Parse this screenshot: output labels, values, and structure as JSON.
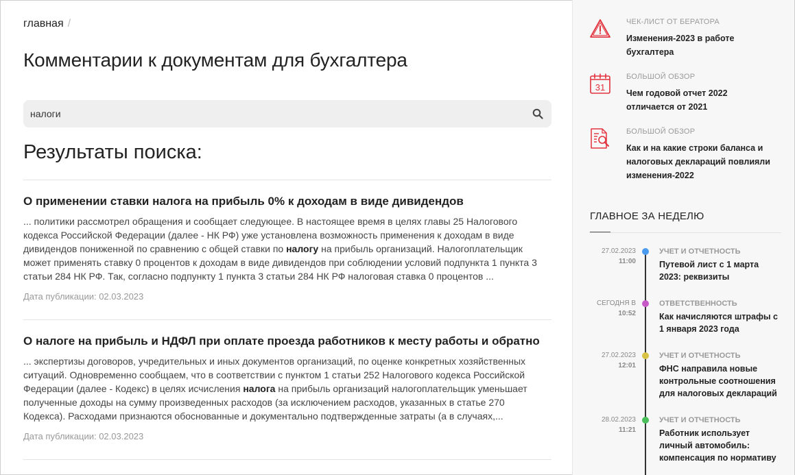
{
  "breadcrumb": {
    "home": "главная",
    "separator": "/"
  },
  "page_title": "Комментарии к документам для бухгалтера",
  "search": {
    "value": "налоги",
    "icon": "search-icon"
  },
  "results_title": "Результаты поиска:",
  "results": [
    {
      "title": "О применении ставки налога на прибыль 0% к доходам в виде дивидендов",
      "title_parts": {
        "pre": "О применении ставки ",
        "bold": "налога",
        "post": " на прибыль 0% к доходам в виде дивидендов"
      },
      "snippet_lines": [
        "... политики рассмотрел обращения и сообщает следующее. В настоящее время в целях главы 25 Налогового",
        "кодекса Российской Федерации (далее - НК РФ) уже установлена возможность применения к доходам в виде",
        "дивидендов пониженной по сравнению с общей ставки по |налогу| на прибыль организаций. Налогоплательщик",
        "может применять ставку 0 процентов к доходам в виде дивидендов при соблюдении условий подпункта 1 пункта 3",
        "статьи 284 НК РФ. Так, согласно подпункту 1 пункта 3 статьи 284 НК РФ налоговая ставка 0 процентов ..."
      ],
      "date": "Дата публикации: 02.03.2023"
    },
    {
      "title": "О налоге на прибыль и НДФЛ при оплате проезда работников к месту работы и обратно",
      "title_parts": {
        "pre": "О ",
        "bold": "налоге",
        "post": " на прибыль и НДФЛ при оплате проезда работников к месту работы и обратно"
      },
      "snippet_lines": [
        "... экспертизы договоров, учредительных и иных документов организаций, по оценке конкретных хозяйственных",
        "ситуаций. Одновременно сообщаем, что в соответствии с пунктом 1 статьи 252 Налогового кодекса Российской",
        "Федерации (далее - Кодекс) в целях исчисления |налога| на прибыль организаций налогоплательщик уменьшает",
        "полученные доходы на сумму произведенных расходов (за исключением расходов, указанных в статье 270",
        "Кодекса). Расходами признаются обоснованные и документально подтвержденные затраты (а в случаях,..."
      ],
      "date": "Дата публикации: 02.03.2023"
    }
  ],
  "sidebar": {
    "accent": "#e2313c",
    "promos": [
      {
        "icon": "warning-icon",
        "kicker": "ЧЕК-ЛИСТ ОТ БЕРАТОРА",
        "title": "Изменения-2023 в работе бухгалтера"
      },
      {
        "icon": "calendar-icon",
        "calendar_day": "31",
        "kicker": "БОЛЬШОЙ ОБЗОР",
        "title": "Чем годовой отчет 2022 отличается от 2021"
      },
      {
        "icon": "document-search-icon",
        "kicker": "БОЛЬШОЙ ОБЗОР",
        "title": "Как и на какие строки баланса и налоговых деклараций повлияли изменения-2022"
      }
    ],
    "week_title": "ГЛАВНОЕ ЗА НЕДЕЛЮ",
    "news": [
      {
        "date": "27.02.2023",
        "time": "11:00",
        "category": "УЧЕТ И ОТЧЕТНОСТЬ",
        "title": "Путевой лист с 1 марта 2023: реквизиты",
        "dot_color": "#4a9af0"
      },
      {
        "date": "СЕГОДНЯ В",
        "time": "10:52",
        "category": "ОТВЕТСТВЕННОСТЬ",
        "title": "Как начисляются штрафы с 1 января 2023 года",
        "dot_color": "#c85ac8"
      },
      {
        "date": "27.02.2023",
        "time": "12:01",
        "category": "УЧЕТ И ОТЧЕТНОСТЬ",
        "title": "ФНС направила новые контрольные соотношения для налоговых деклараций",
        "dot_color": "#d8c246"
      },
      {
        "date": "28.02.2023",
        "time": "11:21",
        "category": "УЧЕТ И ОТЧЕТНОСТЬ",
        "title": "Работник использует личный автомобиль: компенсация по нормативу",
        "dot_color": "#4ac05a"
      }
    ]
  }
}
